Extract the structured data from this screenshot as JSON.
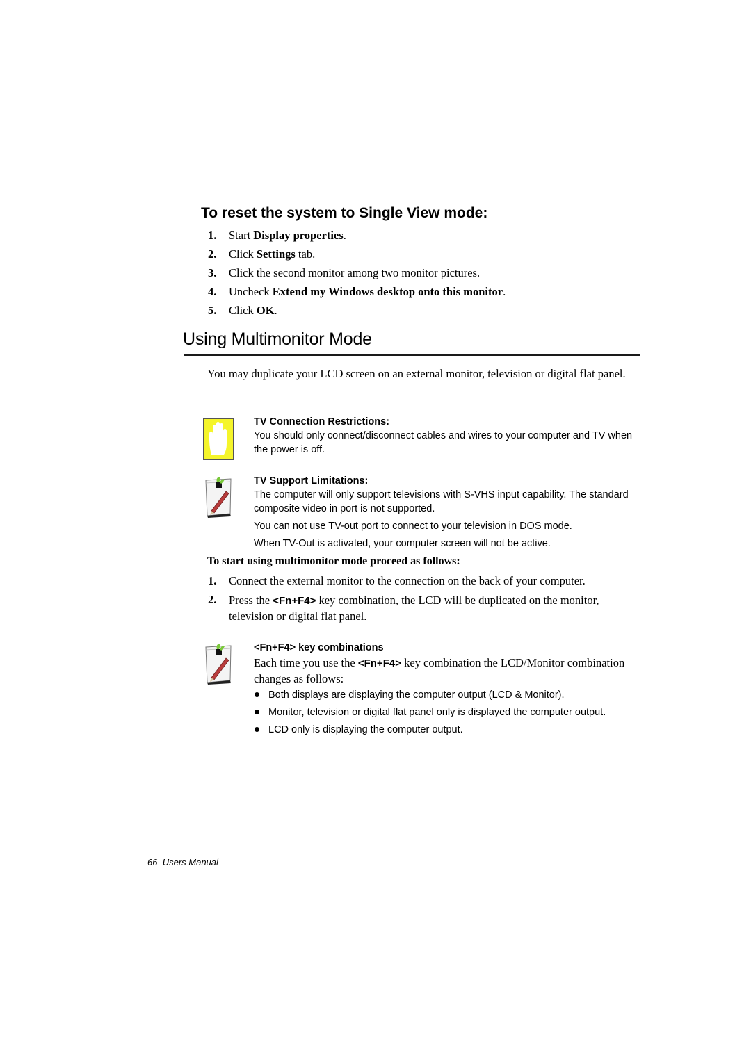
{
  "reset_section": {
    "heading": "To reset the system to Single View mode:",
    "steps": [
      {
        "num": "1.",
        "pre": "Start ",
        "bold": "Display properties",
        "post": "."
      },
      {
        "num": "2.",
        "pre": "Click ",
        "bold": "Settings",
        "post": " tab."
      },
      {
        "num": "3.",
        "pre": "Click the second monitor among two monitor pictures.",
        "bold": "",
        "post": ""
      },
      {
        "num": "4.",
        "pre": "Uncheck ",
        "bold": "Extend my Windows desktop onto this monitor",
        "post": "."
      },
      {
        "num": "5.",
        "pre": "Click ",
        "bold": "OK",
        "post": "."
      }
    ]
  },
  "multimonitor_section": {
    "title": "Using Multimonitor Mode",
    "intro": "You may duplicate your LCD screen on an external monitor, television or digital flat panel.",
    "notes": [
      {
        "icon": "stop-hand-icon",
        "title": "TV Connection Restrictions:",
        "lines": [
          "You should only connect/disconnect cables and wires to your computer and TV when the power is off."
        ]
      },
      {
        "icon": "note-pen-icon",
        "title": "TV Support Limitations:",
        "lines": [
          "The computer will only support televisions with S-VHS input capability. The standard composite video in port is not supported.",
          "You can not use TV-out port to connect to your television in DOS mode.",
          "When TV-Out is activated, your computer screen will not be active."
        ]
      }
    ],
    "procedure_heading": "To start using multimonitor mode proceed as follows:",
    "procedure_steps": [
      {
        "num": "1.",
        "pre": "Connect the external monitor to the connection on the back of your computer.",
        "key": "",
        "post": ""
      },
      {
        "num": "2.",
        "pre": "Press the ",
        "key": "<Fn+F4>",
        "post": " key combination, the LCD will be duplicated on the monitor, television or digital flat panel."
      }
    ],
    "key_note": {
      "icon": "note-pen-icon",
      "title": "<Fn+F4> key combinations",
      "pre": "Each time you use the ",
      "key": "<Fn+F4>",
      "post": " key combination the LCD/Monitor combination changes as follows:",
      "bullets": [
        "Both displays are displaying the computer output (LCD & Monitor).",
        "Monitor, television or digital flat panel only is displayed the computer output.",
        "LCD only is displaying the computer output."
      ]
    }
  },
  "footer": {
    "page_number": "66",
    "doc_title": "Users Manual"
  },
  "colors": {
    "stop_icon_fill": "#f5f52a",
    "pen_body": "#b83b3b",
    "leaf_green": "#7ac93a",
    "rule": "#1a1a1a"
  }
}
